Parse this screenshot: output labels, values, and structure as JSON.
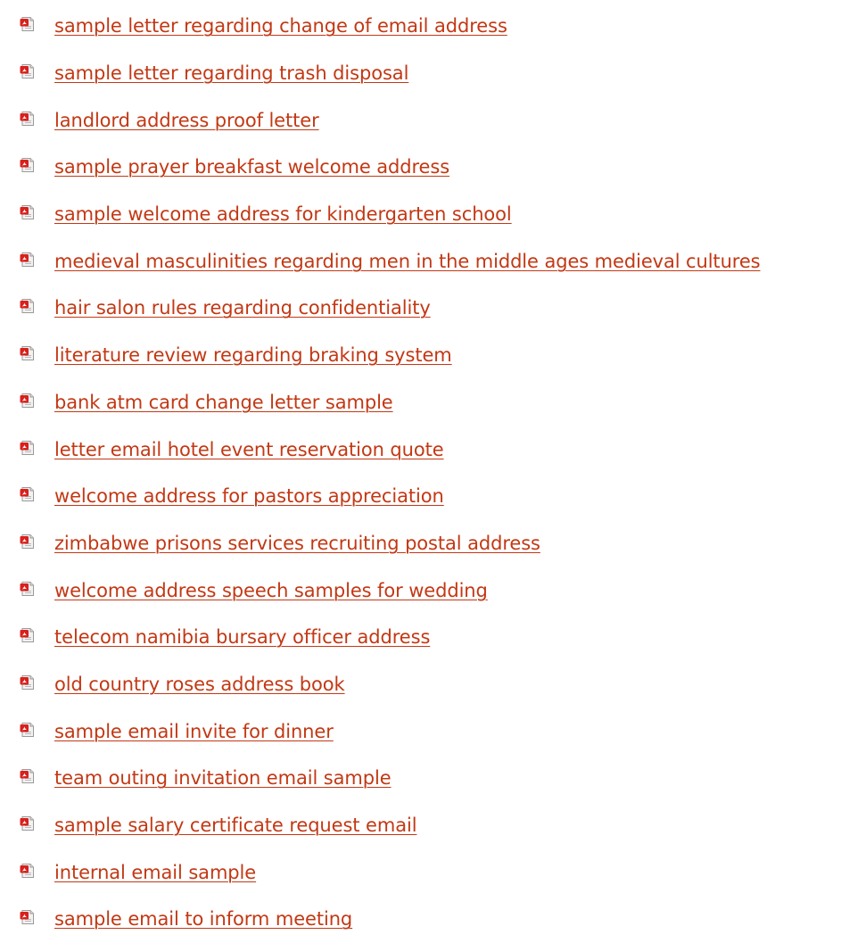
{
  "icon": "pdf-file-icon",
  "link_color": "#c33814",
  "links": [
    {
      "label": "sample letter regarding change of email address"
    },
    {
      "label": "sample letter regarding trash disposal"
    },
    {
      "label": "landlord address proof letter"
    },
    {
      "label": "sample prayer breakfast welcome address"
    },
    {
      "label": "sample welcome address for kindergarten school"
    },
    {
      "label": "medieval masculinities regarding men in the middle ages medieval cultures"
    },
    {
      "label": "hair salon rules regarding confidentiality"
    },
    {
      "label": "literature review regarding braking system"
    },
    {
      "label": "bank atm card change letter sample"
    },
    {
      "label": "letter email hotel event reservation quote"
    },
    {
      "label": "welcome address for pastors appreciation"
    },
    {
      "label": "zimbabwe prisons services recruiting postal address"
    },
    {
      "label": "welcome address speech samples for wedding"
    },
    {
      "label": "telecom namibia bursary officer address"
    },
    {
      "label": "old country roses address book"
    },
    {
      "label": "sample email invite for dinner"
    },
    {
      "label": "team outing invitation email sample"
    },
    {
      "label": "sample salary certificate request email"
    },
    {
      "label": "internal email sample"
    },
    {
      "label": "sample email to inform meeting"
    }
  ]
}
